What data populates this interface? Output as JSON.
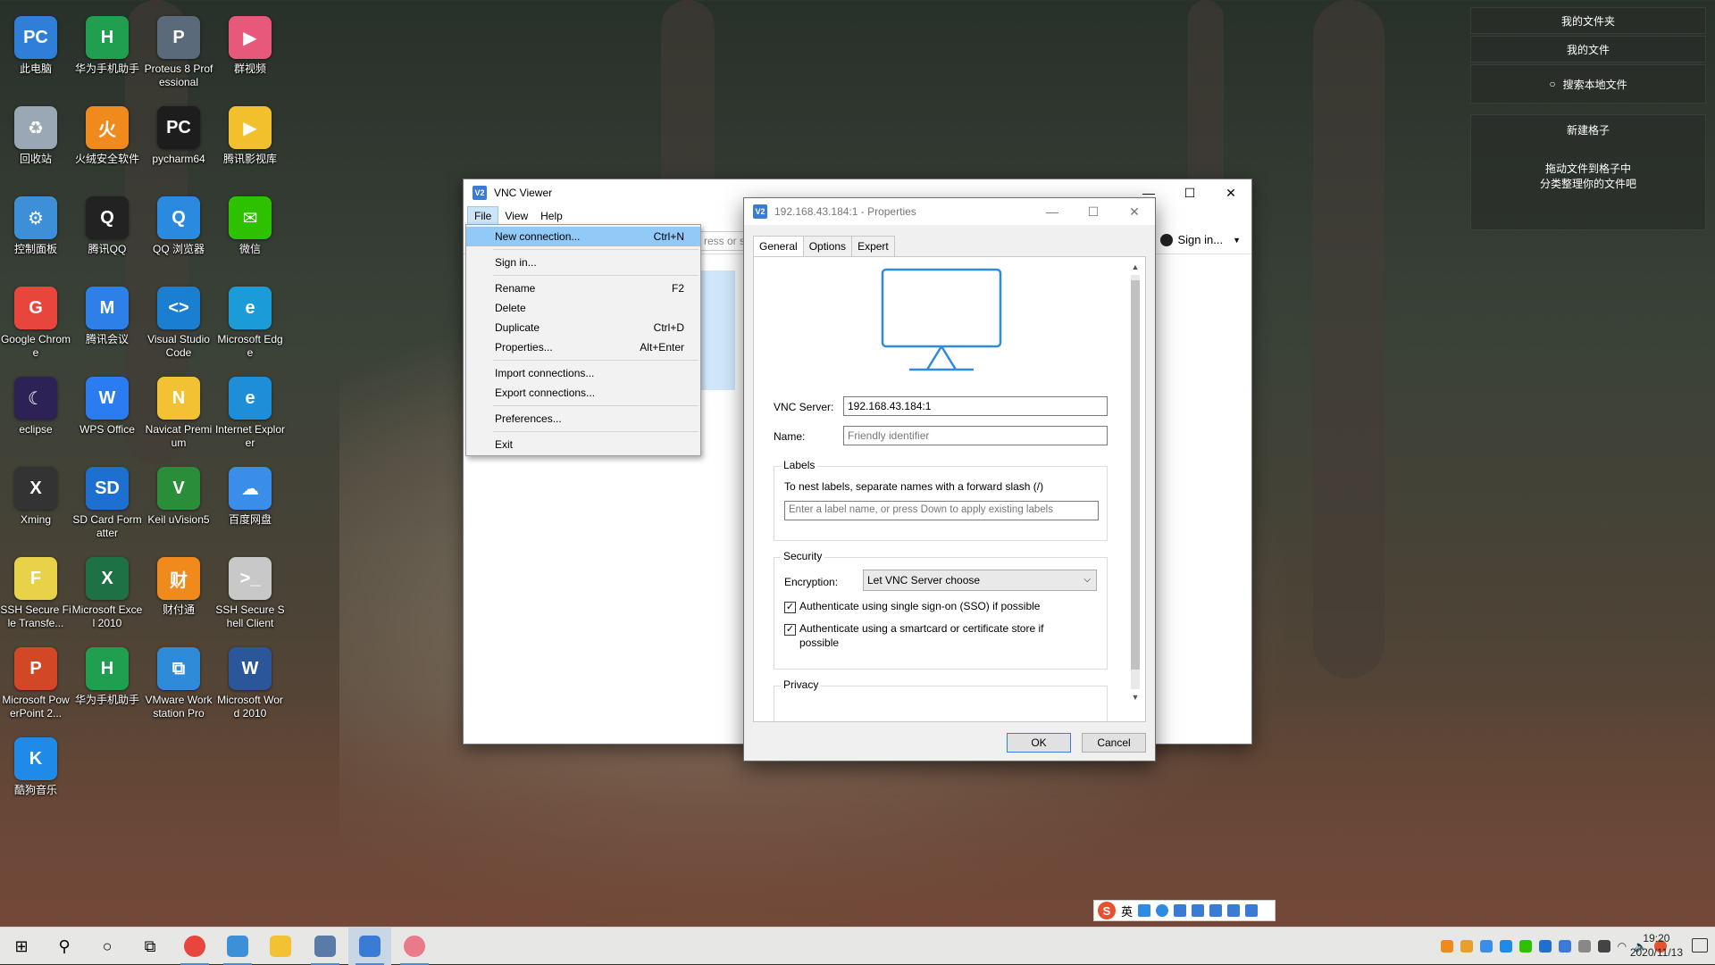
{
  "desktop": {
    "icons": [
      {
        "label": "此电脑",
        "color": "#2f7fd8",
        "glyph": "PC"
      },
      {
        "label": "华为手机助手",
        "color": "#1f9f4f",
        "glyph": "H"
      },
      {
        "label": "Proteus 8 Professional",
        "color": "#5a6a7a",
        "glyph": "P"
      },
      {
        "label": "群视频",
        "color": "#e8587a",
        "glyph": "▶"
      },
      {
        "label": "回收站",
        "color": "#9aa7b5",
        "glyph": "♻"
      },
      {
        "label": "火绒安全软件",
        "color": "#f08a1c",
        "glyph": "火"
      },
      {
        "label": "pycharm64",
        "color": "#1d1d1d",
        "glyph": "PC"
      },
      {
        "label": "腾讯影视库",
        "color": "#f2c02c",
        "glyph": "▶"
      },
      {
        "label": "控制面板",
        "color": "#3d8fd8",
        "glyph": "⚙"
      },
      {
        "label": "腾讯QQ",
        "color": "#222222",
        "glyph": "Q"
      },
      {
        "label": "QQ 浏览器",
        "color": "#2a8ae0",
        "glyph": "Q"
      },
      {
        "label": "微信",
        "color": "#2dc100",
        "glyph": "✉"
      },
      {
        "label": "Google Chrome",
        "color": "#e8453c",
        "glyph": "G"
      },
      {
        "label": "腾讯会议",
        "color": "#2f7fe8",
        "glyph": "M"
      },
      {
        "label": "Visual Studio Code",
        "color": "#1a7ed1",
        "glyph": "<>"
      },
      {
        "label": "Microsoft Edge",
        "color": "#1b9bd8",
        "glyph": "e"
      },
      {
        "label": "eclipse",
        "color": "#2c2255",
        "glyph": "☾"
      },
      {
        "label": "WPS Office",
        "color": "#2b7cf0",
        "glyph": "W"
      },
      {
        "label": "Navicat Premium",
        "color": "#f2c234",
        "glyph": "N"
      },
      {
        "label": "Internet Explorer",
        "color": "#1e8ed8",
        "glyph": "e"
      },
      {
        "label": "Xming",
        "color": "#333333",
        "glyph": "X"
      },
      {
        "label": "SD Card Formatter",
        "color": "#1d6fd0",
        "glyph": "SD"
      },
      {
        "label": "Keil uVision5",
        "color": "#2a8d3a",
        "glyph": "V"
      },
      {
        "label": "百度网盘",
        "color": "#3a8de8",
        "glyph": "☁"
      },
      {
        "label": "SSH Secure File Transfe...",
        "color": "#e8d24a",
        "glyph": "F"
      },
      {
        "label": "Microsoft Excel 2010",
        "color": "#1e7145",
        "glyph": "X"
      },
      {
        "label": "财付通",
        "color": "#f08a1c",
        "glyph": "财"
      },
      {
        "label": "SSH Secure Shell Client",
        "color": "#c8c8c8",
        "glyph": ">_"
      },
      {
        "label": "Microsoft PowerPoint 2...",
        "color": "#d24726",
        "glyph": "P"
      },
      {
        "label": "华为手机助手",
        "color": "#1f9f4f",
        "glyph": "H"
      },
      {
        "label": "VMware Workstation Pro",
        "color": "#2f8ad8",
        "glyph": "⧉"
      },
      {
        "label": "Microsoft Word 2010",
        "color": "#2b579a",
        "glyph": "W"
      },
      {
        "label": "酷狗音乐",
        "color": "#1f8ae8",
        "glyph": "K"
      }
    ]
  },
  "fences": {
    "btn1": "我的文件夹",
    "btn2": "我的文件",
    "search": "搜索本地文件",
    "new_fence": "新建格子",
    "hint1": "拖动文件到格子中",
    "hint2": "分类整理你的文件吧"
  },
  "vnc": {
    "title": "VNC Viewer",
    "menu": [
      "File",
      "View",
      "Help"
    ],
    "search_placeholder": "ress or s",
    "signin": "Sign in...",
    "dropdown": [
      {
        "label": "New connection...",
        "shortcut": "Ctrl+N"
      },
      {
        "label": "Sign in...",
        "shortcut": ""
      },
      {
        "label": "Rename",
        "shortcut": "F2"
      },
      {
        "label": "Delete",
        "shortcut": ""
      },
      {
        "label": "Duplicate",
        "shortcut": "Ctrl+D"
      },
      {
        "label": "Properties...",
        "shortcut": "Alt+Enter"
      },
      {
        "label": "Import connections...",
        "shortcut": ""
      },
      {
        "label": "Export connections...",
        "shortcut": ""
      },
      {
        "label": "Preferences...",
        "shortcut": ""
      },
      {
        "label": "Exit",
        "shortcut": ""
      }
    ]
  },
  "props": {
    "title": "192.168.43.184:1 - Properties",
    "tabs": [
      "General",
      "Options",
      "Expert"
    ],
    "server_label": "VNC Server:",
    "server_value": "192.168.43.184:1",
    "name_label": "Name:",
    "name_placeholder": "Friendly identifier",
    "labels_title": "Labels",
    "labels_hint": "To nest labels, separate names with a forward slash (/)",
    "labels_placeholder": "Enter a label name, or press Down to apply existing labels",
    "security_title": "Security",
    "encryption_label": "Encryption:",
    "encryption_value": "Let VNC Server choose",
    "cb1": "Authenticate using single sign-on (SSO) if possible",
    "cb2a": "Authenticate using a smartcard or certificate store if",
    "cb2b": "possible",
    "privacy_title": "Privacy",
    "ok": "OK",
    "cancel": "Cancel"
  },
  "taskbar": {
    "time": "19:20",
    "date": "2020/11/13"
  },
  "ime": {
    "s": "S",
    "lang": "英"
  },
  "colors": {
    "accent": "#4a8ad6",
    "menu_highlight": "#91c9f7",
    "vnc_blue": "#3a7bd5"
  }
}
